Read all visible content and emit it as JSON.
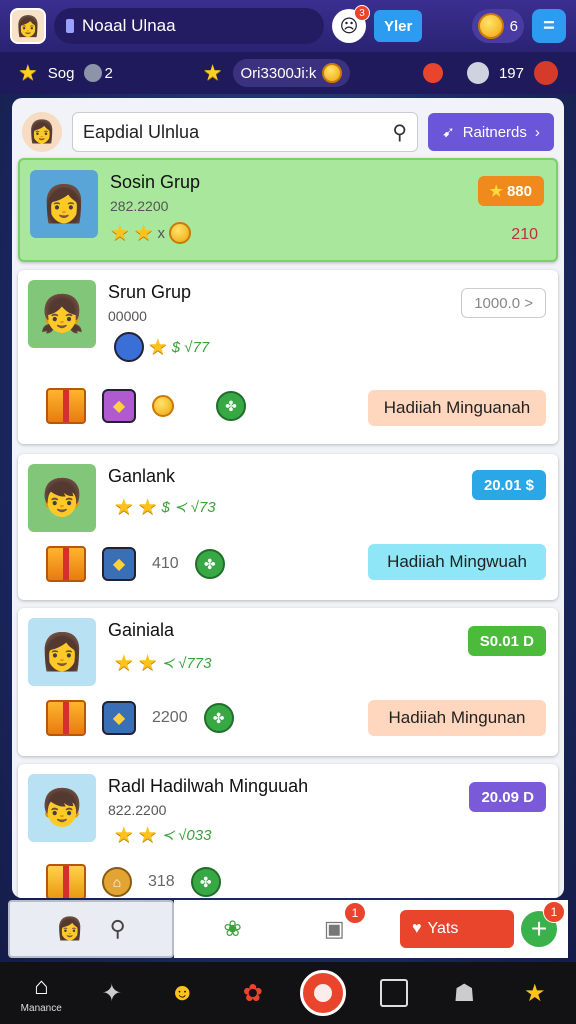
{
  "topbar": {
    "title": "Noaal Ulnaa",
    "notif_count": "3",
    "blue_button": "Yler",
    "coin_value": "6",
    "menu_symbol": "="
  },
  "stats": {
    "left_label": "Sog",
    "left_suffix": "2",
    "center_value": "Ori3300Ji:k",
    "right_value": "197"
  },
  "search": {
    "value": "Eapdial Ulnlua",
    "rewards_label": "Raitnerds"
  },
  "cards": [
    {
      "name": "Sosin Grup",
      "sub": "282.2200",
      "stars_suffix": "x",
      "badge": "880",
      "value": "210"
    },
    {
      "name": "Srun Grup",
      "sub": "00000",
      "stars_text": "$ √77",
      "badge": "1000.0 >",
      "reward": "Hadiiah Minguanah"
    },
    {
      "name": "Ganlank",
      "stars_text": "$ ≺ √73",
      "badge": "20.01 $",
      "item_value": "410",
      "reward": "Hadiiah Mingwuah"
    },
    {
      "name": "Gainiala",
      "stars_text": "≺ √773",
      "badge": "S0.01 D",
      "item_value": "2200",
      "reward": "Hadiiah Mingunan"
    },
    {
      "name": "Radl Hadilwah Minguuah",
      "sub": "822.2200",
      "stars_text": "≺ √033",
      "badge": "20.09 D",
      "item_value": "318"
    }
  ],
  "action_strip": {
    "notif_1": "1",
    "notif_2": "1",
    "red_pill_label": "Yats"
  },
  "nav": {
    "home_label": "Manance"
  },
  "colors": {
    "accent_purple": "#6b55d8",
    "highlight_green": "#a9e79c",
    "badge_orange": "#f08a1c",
    "badge_blue": "#2aa7e6",
    "badge_green": "#4cbb3b",
    "badge_violet": "#7a5ad9",
    "reward_peach": "#ffd7bf",
    "reward_cyan": "#8fe6f6"
  }
}
